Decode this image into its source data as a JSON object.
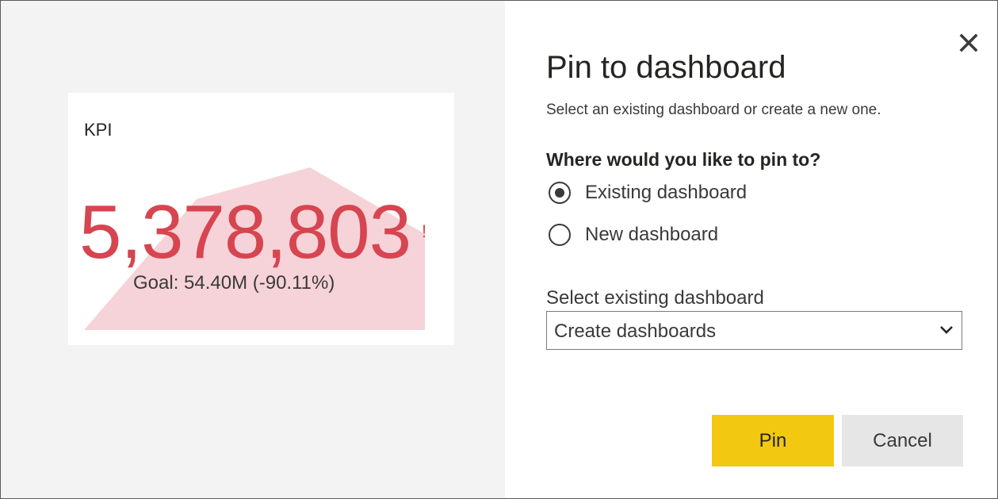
{
  "dialog": {
    "title": "Pin to dashboard",
    "subtitle": "Select an existing dashboard or create a new one.",
    "close_icon": "close-icon"
  },
  "preview": {
    "card_title": "KPI",
    "value": "5,378,803",
    "indicator": "!",
    "goal": "Goal: 54.40M (-90.11%)",
    "colors": {
      "value": "#d64550",
      "trend_fill": "#f6d3d8",
      "pane_background": "#f3f3f3"
    }
  },
  "pin_target": {
    "question": "Where would you like to pin to?",
    "options": [
      {
        "label": "Existing dashboard",
        "selected": true
      },
      {
        "label": "New dashboard",
        "selected": false
      }
    ]
  },
  "dashboard_select": {
    "label": "Select existing dashboard",
    "value": "Create dashboards",
    "chevron_icon": "chevron-down-icon"
  },
  "buttons": {
    "pin": "Pin",
    "cancel": "Cancel",
    "pin_color": "#f2c811",
    "cancel_color": "#e6e6e6"
  }
}
